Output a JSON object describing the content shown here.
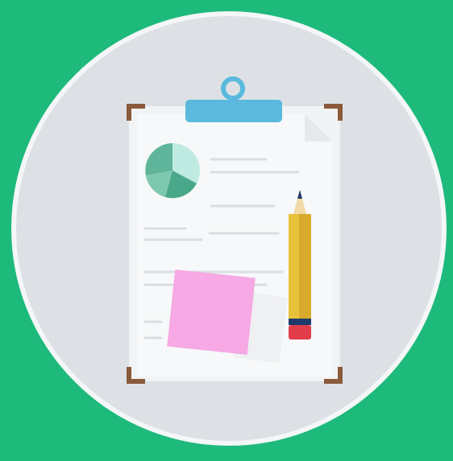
{
  "illustration": {
    "subject": "clipboard-with-report-pie-chart-sticky-note-and-pencil",
    "icons": [
      "clipboard-icon",
      "pie-chart-icon",
      "sticky-note-icon",
      "pencil-icon"
    ],
    "colors": {
      "background": "#1dba7b",
      "circle": "#dde1e6",
      "circle_border": "#f4f6f7",
      "clip": "#5ab9dc",
      "board_corner": "#8a5a3a",
      "paper": "#f7f8f9",
      "pie_main": "#5fb59a",
      "pie_light": "#bfeae2",
      "sticky_note": "#f6a9e4",
      "pencil_body": "#e9c23b",
      "pencil_band": "#1f3b6e",
      "pencil_eraser": "#e23d4a"
    }
  }
}
